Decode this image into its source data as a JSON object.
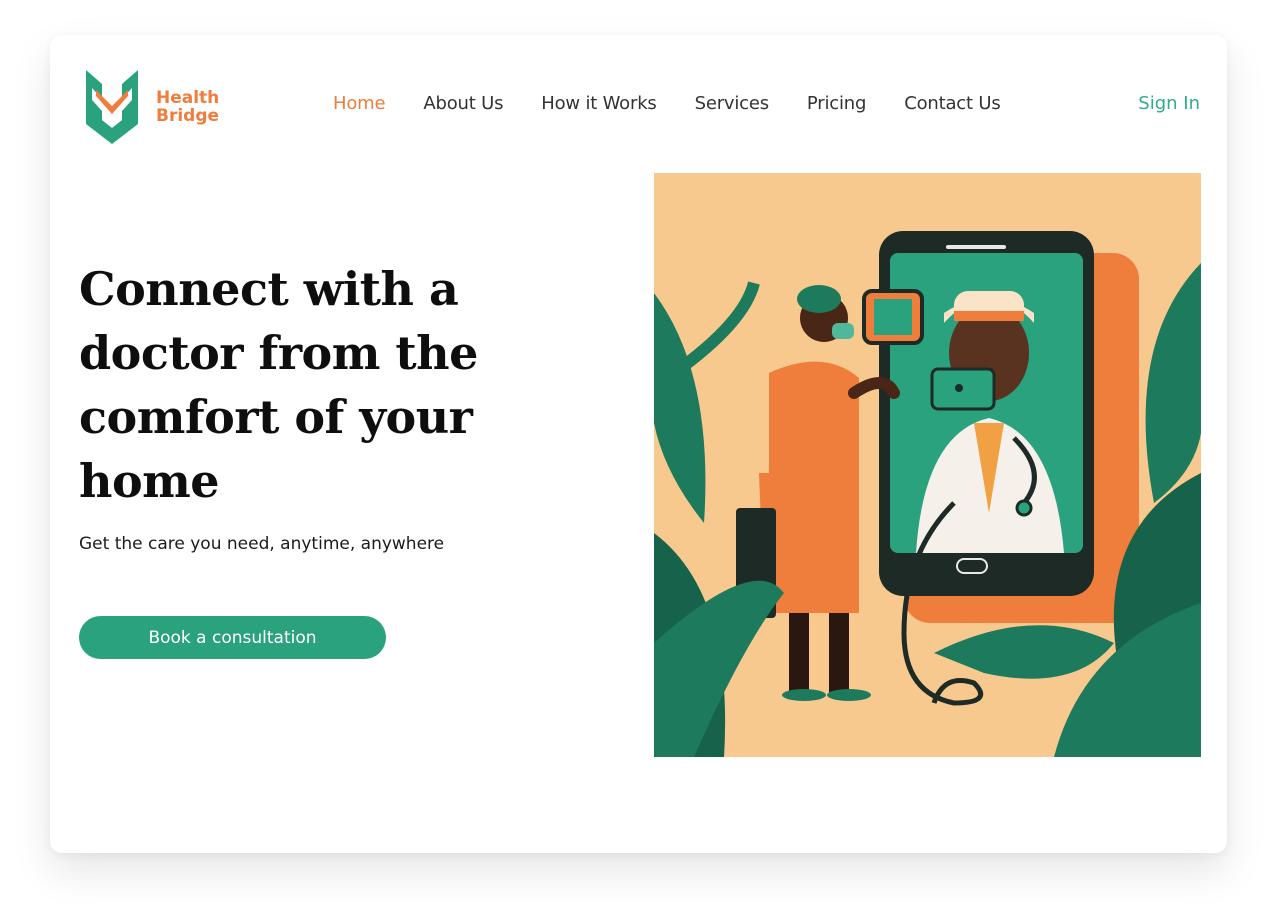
{
  "brand": {
    "name_line1": "Health",
    "name_line2": "Bridge",
    "icon": "health-bridge-logo-icon"
  },
  "nav": {
    "items": [
      {
        "label": "Home",
        "active": true
      },
      {
        "label": "About Us",
        "active": false
      },
      {
        "label": "How it Works",
        "active": false
      },
      {
        "label": "Services",
        "active": false
      },
      {
        "label": "Pricing",
        "active": false
      },
      {
        "label": "Contact Us",
        "active": false
      }
    ],
    "signin_label": "Sign In"
  },
  "hero": {
    "headline": "Connect with a doctor from the comfort of your home",
    "subtitle": "Get the care you need, anytime, anywhere",
    "cta_label": "Book a consultation",
    "illustration": "telemedicine-video-call-illustration"
  },
  "colors": {
    "accent_orange": "#ef7d3c",
    "accent_green": "#2aa27d",
    "signin_green": "#2fae87",
    "illustration_bg": "#f8c98e",
    "leaf_green": "#1e7a5c",
    "phone_dark": "#1e2a25"
  }
}
